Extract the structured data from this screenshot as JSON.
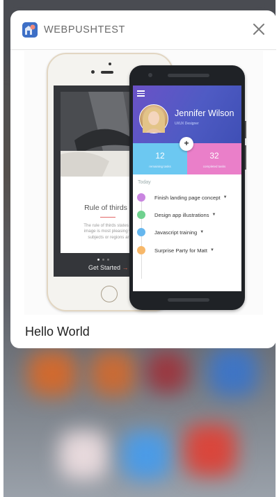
{
  "notification": {
    "app_name": "WEBPUSHTEST",
    "title": "Hello World",
    "icons": {
      "app": "webpush-app-icon",
      "close": "close-icon"
    }
  },
  "image": {
    "iphone": {
      "heading": "Rule of thirds",
      "body": "The rule of thirds states th\nimage is most pleasing wl\nsubjects or regions ar",
      "cta": "Get Started",
      "cta_arrow": "→"
    },
    "android": {
      "profile_name": "Jennifer Wilson",
      "profile_role": "UI/UX Designer",
      "plus": "+",
      "stats": [
        {
          "value": "12",
          "label": "remaining tasks"
        },
        {
          "value": "32",
          "label": "completed tasks"
        }
      ],
      "section": "Today",
      "tasks": [
        {
          "label": "Finish landing page concept",
          "color": "#c985e0"
        },
        {
          "label": "Design app illustrations",
          "color": "#6fd18f"
        },
        {
          "label": "Javascript training",
          "color": "#66b7ee"
        },
        {
          "label": "Surprise Party for Matt",
          "color": "#f7b86a"
        }
      ]
    }
  }
}
